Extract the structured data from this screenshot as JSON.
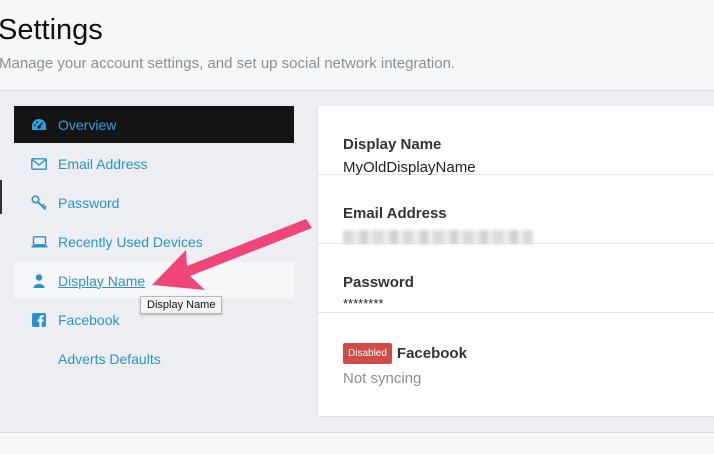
{
  "header": {
    "title": "Settings",
    "subtitle": "Manage your account settings, and set up social network integration."
  },
  "sidebar": {
    "items": [
      {
        "label": "Overview",
        "icon": "dashboard-icon"
      },
      {
        "label": "Email Address",
        "icon": "envelope-icon"
      },
      {
        "label": "Password",
        "icon": "key-icon"
      },
      {
        "label": "Recently Used Devices",
        "icon": "laptop-icon"
      },
      {
        "label": "Display Name",
        "icon": "user-icon"
      },
      {
        "label": "Facebook",
        "icon": "facebook-icon"
      },
      {
        "label": "Adverts Defaults",
        "icon": ""
      }
    ]
  },
  "tooltip": {
    "text": "Display Name"
  },
  "panel": {
    "display_name": {
      "label": "Display Name",
      "value": "MyOldDisplayName"
    },
    "email": {
      "label": "Email Address"
    },
    "password": {
      "label": "Password",
      "value": "********"
    },
    "facebook": {
      "badge": "Disabled",
      "label": "Facebook",
      "status": "Not syncing"
    }
  },
  "colors": {
    "link": "#2a93cf",
    "active_bg": "#141414",
    "badge": "#cf4b46",
    "arrow": "#f0457a"
  }
}
